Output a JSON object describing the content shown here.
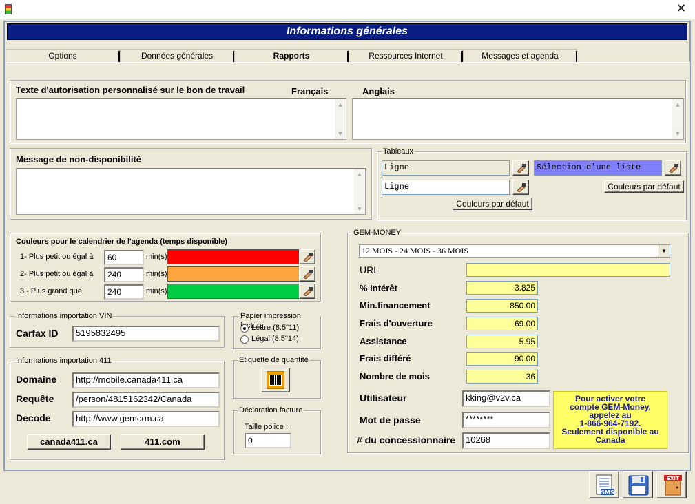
{
  "window": {
    "close_glyph": "✕",
    "app_icon": "traffic-light-icon"
  },
  "header": {
    "title": "Informations générales"
  },
  "tabs": [
    {
      "label": "Options"
    },
    {
      "label": "Données générales"
    },
    {
      "label": "Rapports"
    },
    {
      "label": "Ressources Internet"
    },
    {
      "label": "Messages et agenda"
    }
  ],
  "authorization": {
    "title": "Texte d'autorisation personnalisé sur le bon de travail",
    "french_label": "Français",
    "english_label": "Anglais",
    "french_value": "",
    "english_value": ""
  },
  "unavailable": {
    "title": "Message de non-disponibilité",
    "value": ""
  },
  "tableaux": {
    "legend": "Tableaux",
    "row1_value": "Ligne",
    "row2_value": "Ligne",
    "selection_value": "Sélection d'une liste",
    "default_colors_left": "Couleurs par défaut",
    "default_colors_right": "Couleurs par défaut",
    "selection_color": "#8080ff"
  },
  "calendar_colors": {
    "title": "Couleurs pour le calendrier de l'agenda (temps disponible)",
    "unit": "min(s)",
    "rows": [
      {
        "label": "1- Plus petit ou égal à",
        "value": "60",
        "color": "#ff0000"
      },
      {
        "label": "2- Plus petit ou égal à",
        "value": "240",
        "color": "#ffa640"
      },
      {
        "label": "3 - Plus grand que",
        "value": "240",
        "color": "#00cc44"
      }
    ]
  },
  "vin": {
    "legend": "Informations importation VIN",
    "carfax_label": "Carfax ID",
    "carfax_value": "5195832495"
  },
  "paper": {
    "legend": "Papier impression facture",
    "letter": "Lettre (8.5\"11)",
    "legal": "Légal (8.5\"14)"
  },
  "quantity_label": {
    "legend": "Etiquette de quantité"
  },
  "invoice": {
    "legend": "Déclaration facture",
    "font_size_label": "Taille police :",
    "font_size_value": "0"
  },
  "import411": {
    "legend": "Informations importation 411",
    "domain_label": "Domaine",
    "domain_value": "http://mobile.canada411.ca",
    "request_label": "Requête",
    "request_value": "/person/4815162342/Canada",
    "decode_label": "Decode",
    "decode_value": "http://www.gemcrm.ca",
    "btn_canada": "canada411.ca",
    "btn_411": "411.com"
  },
  "gem": {
    "legend": "GEM-MONEY",
    "select_value": "12 MOIS - 24 MOIS - 36 MOIS",
    "url_label": "URL",
    "url_value": "",
    "interest_label": "% Intérêt",
    "interest_value": "3.825",
    "min_label": "Min.financement",
    "min_value": "850.00",
    "opening_label": "Frais d'ouverture",
    "opening_value": "69.00",
    "assistance_label": "Assistance",
    "assistance_value": "5.95",
    "deferred_label": "Frais différé",
    "deferred_value": "90.00",
    "months_label": "Nombre de mois",
    "months_value": "36",
    "user_label": "Utilisateur",
    "user_value": "kking@v2v.ca",
    "password_label": "Mot de passe",
    "password_value": "********",
    "dealer_label": "# du concessionnaire",
    "dealer_value": "10268",
    "notice_l1": "Pour activer votre",
    "notice_l2": "compte GEM-Money,",
    "notice_l3": "appelez au",
    "notice_l4": "1-866-964-7192.",
    "notice_l5": "Seulement disponible au",
    "notice_l6": "Canada"
  },
  "footer": {
    "sms_icon": "sms-icon",
    "save_icon": "floppy-save-icon",
    "exit_icon": "exit-door-icon"
  }
}
